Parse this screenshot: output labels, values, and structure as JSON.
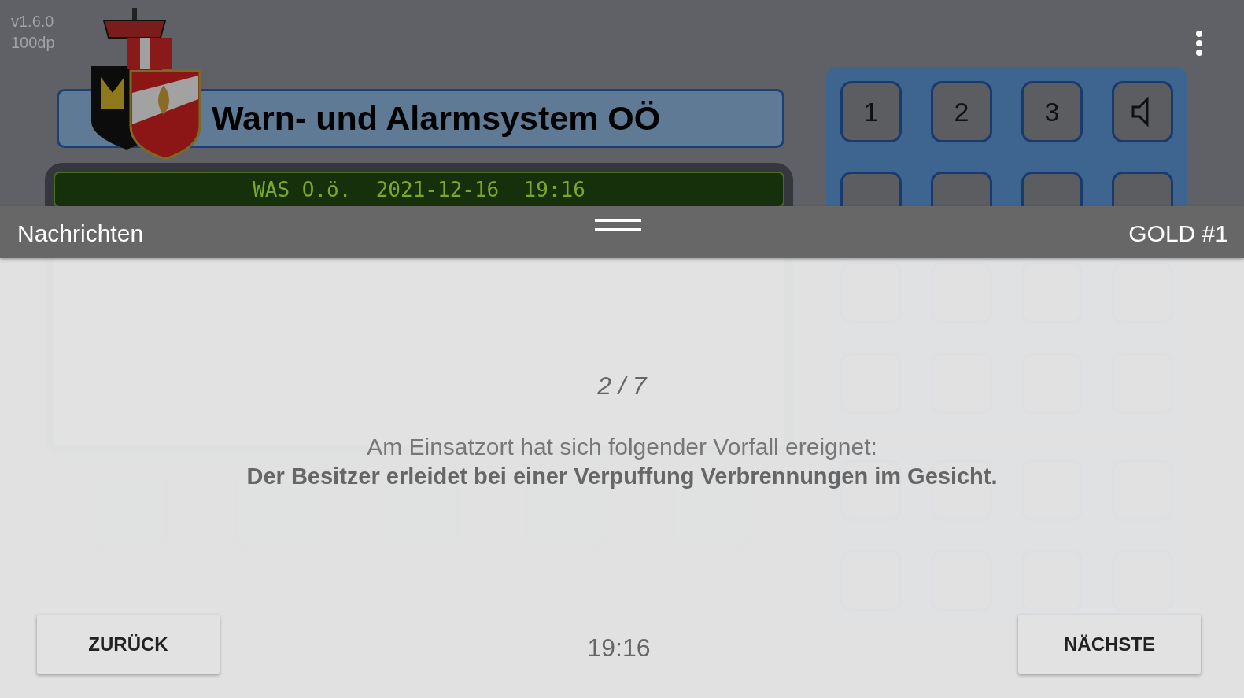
{
  "app": {
    "version": "v1.6.0",
    "density": "100dp",
    "title": "Warn- und Alarmsystem OÖ",
    "status_line": "WAS O.ö.  2021-12-16  19:16",
    "keypad": [
      {
        "kind": "text",
        "label": "1"
      },
      {
        "kind": "text",
        "label": "2"
      },
      {
        "kind": "text",
        "label": "3"
      },
      {
        "kind": "speaker"
      }
    ]
  },
  "sheet": {
    "title": "Nachrichten",
    "account": "GOLD #1",
    "counter": "2 / 7",
    "intro": "Am Einsatzort hat sich folgender Vorfall ereignet:",
    "message": "Der Besitzer erleidet bei einer Verpuffung Verbrennungen im Gesicht.",
    "back_button": "ZURÜCK",
    "next_button": "NÄCHSTE",
    "time": "19:16"
  }
}
